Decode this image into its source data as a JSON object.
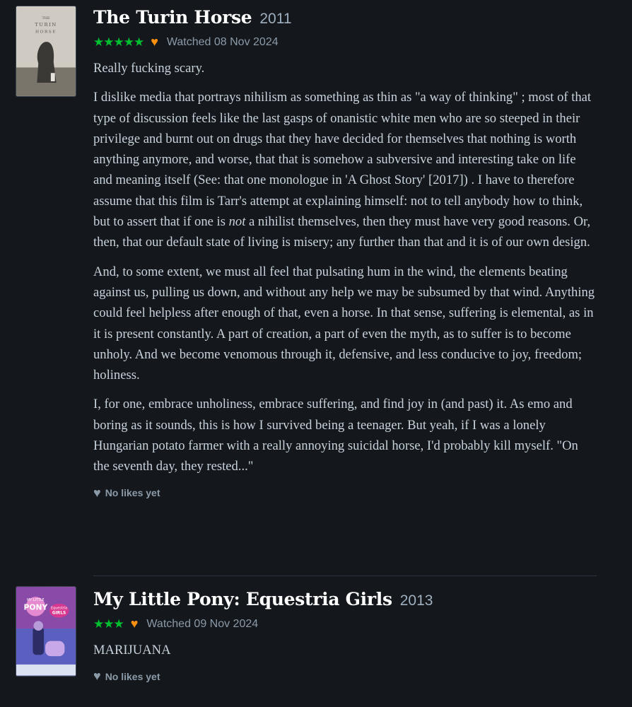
{
  "reviews": [
    {
      "poster_text": [
        "THE",
        "TURIN",
        "HORSE"
      ],
      "title": "The Turin Horse",
      "year": "2011",
      "stars": "★★★★★",
      "watched": "Watched 08 Nov 2024",
      "paragraphs": [
        "Really fucking scary.",
        "I dislike media that portrays nihilism as something as thin as \"a way of thinking\" ; most of that type of discussion feels like the last gasps of onanistic white men who are so steeped in their privilege and burnt out on drugs that they have decided for themselves that nothing is worth anything anymore, and worse, that that is somehow a subversive and interesting take on life and meaning itself (See: that one monologue in 'A Ghost Story' [2017]) . I have to therefore assume that this film is Tarr's attempt at explaining himself: not to tell anybody how to think, but to assert that if one is",
        "not",
        "a nihilist themselves, then they must have very good reasons. Or, then, that our default state of living is misery; any further than that and it is of our own design.",
        "And, to some extent, we must all feel that pulsating hum in the wind, the elements beating against us, pulling us down, and without any help we may be subsumed by that wind. Anything could feel helpless after enough of that, even a horse. In that sense, suffering is elemental, as in it is present constantly. A part of creation, a part of even the myth, as to suffer is to become unholy. And we become venomous through it, defensive, and less conducive to joy, freedom; holiness.",
        "I, for one, embrace unholiness, embrace suffering, and find joy in (and past) it. As emo and boring as it sounds, this is how I survived being a teenager. But yeah, if I was a lonely Hungarian potato farmer with a really annoying suicidal horse, I'd probably kill myself. \"On the seventh day, they rested...\""
      ],
      "likes": "No likes yet"
    },
    {
      "poster_text": [
        "MY LITTLE",
        "PONY",
        "Equestria",
        "GIRLS"
      ],
      "title": "My Little Pony: Equestria Girls",
      "year": "2013",
      "stars": "★★★",
      "watched": "Watched 09 Nov 2024",
      "paragraphs": [
        "MARIJUANA"
      ],
      "likes": "No likes yet"
    }
  ],
  "colors": {
    "background": "#14181c",
    "star_green": "#00c030",
    "heart_orange": "#ff9010",
    "title_white": "#ffffff",
    "body_text": "#c8d2dc",
    "muted": "#8c9aa8"
  },
  "icons": {
    "liked": "heart-icon",
    "likes": "heart-outline-icon",
    "rating": "star-icon"
  }
}
